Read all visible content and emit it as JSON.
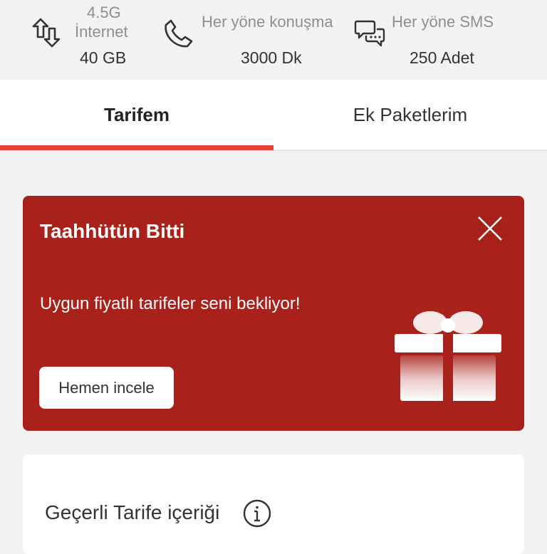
{
  "stats": {
    "internet": {
      "network": "4.5G",
      "label": "İnternet",
      "value": "40 GB",
      "icon": "data-transfer-icon"
    },
    "voice": {
      "label": "Her yöne konuşma",
      "value": "3000 Dk",
      "icon": "phone-icon"
    },
    "sms": {
      "label": "Her yöne SMS",
      "value": "250 Adet",
      "icon": "chat-bubbles-icon"
    }
  },
  "tabs": [
    {
      "label": "Tarifem",
      "active": true
    },
    {
      "label": "Ek Paketlerim",
      "active": false
    }
  ],
  "promo": {
    "title": "Taahhütün Bitti",
    "message": "Uygun fiyatlı tarifeler seni bekliyor!",
    "button_label": "Hemen incele",
    "icon": "gift-icon"
  },
  "tariff": {
    "title": "Geçerli Tarife içeriği",
    "icon": "info-icon"
  },
  "colors": {
    "accent": "#e34234",
    "promo_background": "#a8211b",
    "background": "#f2f2f2"
  }
}
